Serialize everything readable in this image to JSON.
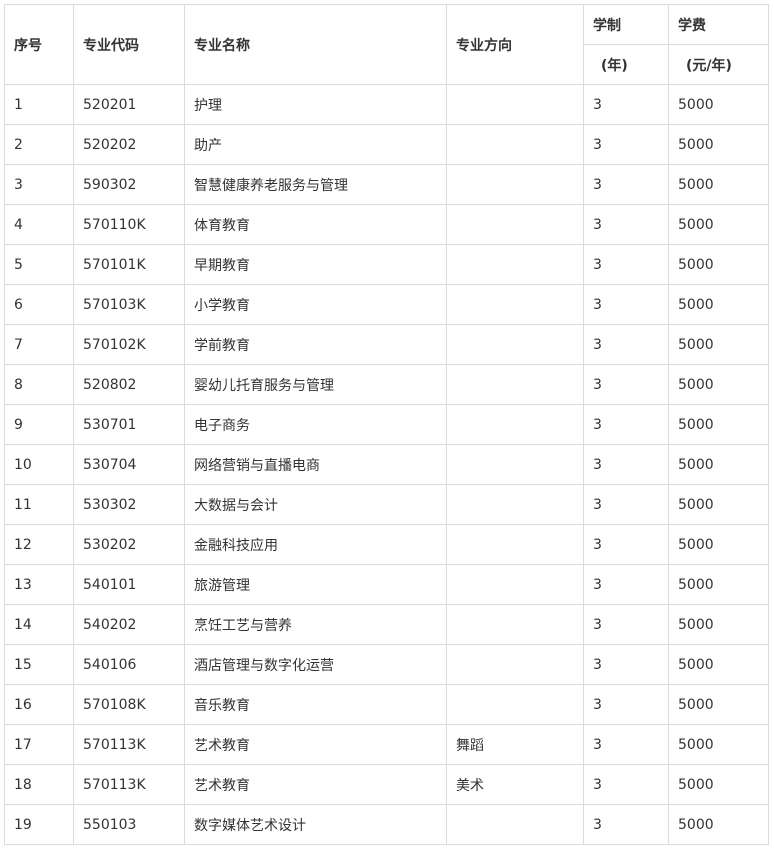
{
  "headers": {
    "index": "序号",
    "code": "专业代码",
    "name": "专业名称",
    "direction": "专业方向",
    "years_top": "学制",
    "years_unit": "(年)",
    "fee_top": "学费",
    "fee_unit": "(元/年)"
  },
  "rows": [
    {
      "index": "1",
      "code": "520201",
      "name": "护理",
      "direction": "",
      "years": "3",
      "fee": "5000"
    },
    {
      "index": "2",
      "code": "520202",
      "name": "助产",
      "direction": "",
      "years": "3",
      "fee": "5000"
    },
    {
      "index": "3",
      "code": "590302",
      "name": "智慧健康养老服务与管理",
      "direction": "",
      "years": "3",
      "fee": "5000"
    },
    {
      "index": "4",
      "code": "570110K",
      "name": "体育教育",
      "direction": "",
      "years": "3",
      "fee": "5000"
    },
    {
      "index": "5",
      "code": "570101K",
      "name": "早期教育",
      "direction": "",
      "years": "3",
      "fee": "5000"
    },
    {
      "index": "6",
      "code": "570103K",
      "name": "小学教育",
      "direction": "",
      "years": "3",
      "fee": "5000"
    },
    {
      "index": "7",
      "code": "570102K",
      "name": "学前教育",
      "direction": "",
      "years": "3",
      "fee": "5000"
    },
    {
      "index": "8",
      "code": "520802",
      "name": "婴幼儿托育服务与管理",
      "direction": "",
      "years": "3",
      "fee": "5000"
    },
    {
      "index": "9",
      "code": "530701",
      "name": "电子商务",
      "direction": "",
      "years": "3",
      "fee": "5000"
    },
    {
      "index": "10",
      "code": "530704",
      "name": "网络营销与直播电商",
      "direction": "",
      "years": "3",
      "fee": "5000"
    },
    {
      "index": "11",
      "code": "530302",
      "name": "大数据与会计",
      "direction": "",
      "years": "3",
      "fee": "5000"
    },
    {
      "index": "12",
      "code": "530202",
      "name": "金融科技应用",
      "direction": "",
      "years": "3",
      "fee": "5000"
    },
    {
      "index": "13",
      "code": "540101",
      "name": "旅游管理",
      "direction": "",
      "years": "3",
      "fee": "5000"
    },
    {
      "index": "14",
      "code": "540202",
      "name": "烹饪工艺与营养",
      "direction": "",
      "years": "3",
      "fee": "5000"
    },
    {
      "index": "15",
      "code": "540106",
      "name": "酒店管理与数字化运营",
      "direction": "",
      "years": "3",
      "fee": "5000"
    },
    {
      "index": "16",
      "code": "570108K",
      "name": "音乐教育",
      "direction": "",
      "years": "3",
      "fee": "5000"
    },
    {
      "index": "17",
      "code": "570113K",
      "name": "艺术教育",
      "direction": "舞蹈",
      "years": "3",
      "fee": "5000"
    },
    {
      "index": "18",
      "code": "570113K",
      "name": "艺术教育",
      "direction": "美术",
      "years": "3",
      "fee": "5000"
    },
    {
      "index": "19",
      "code": "550103",
      "name": "数字媒体艺术设计",
      "direction": "",
      "years": "3",
      "fee": "5000"
    }
  ]
}
